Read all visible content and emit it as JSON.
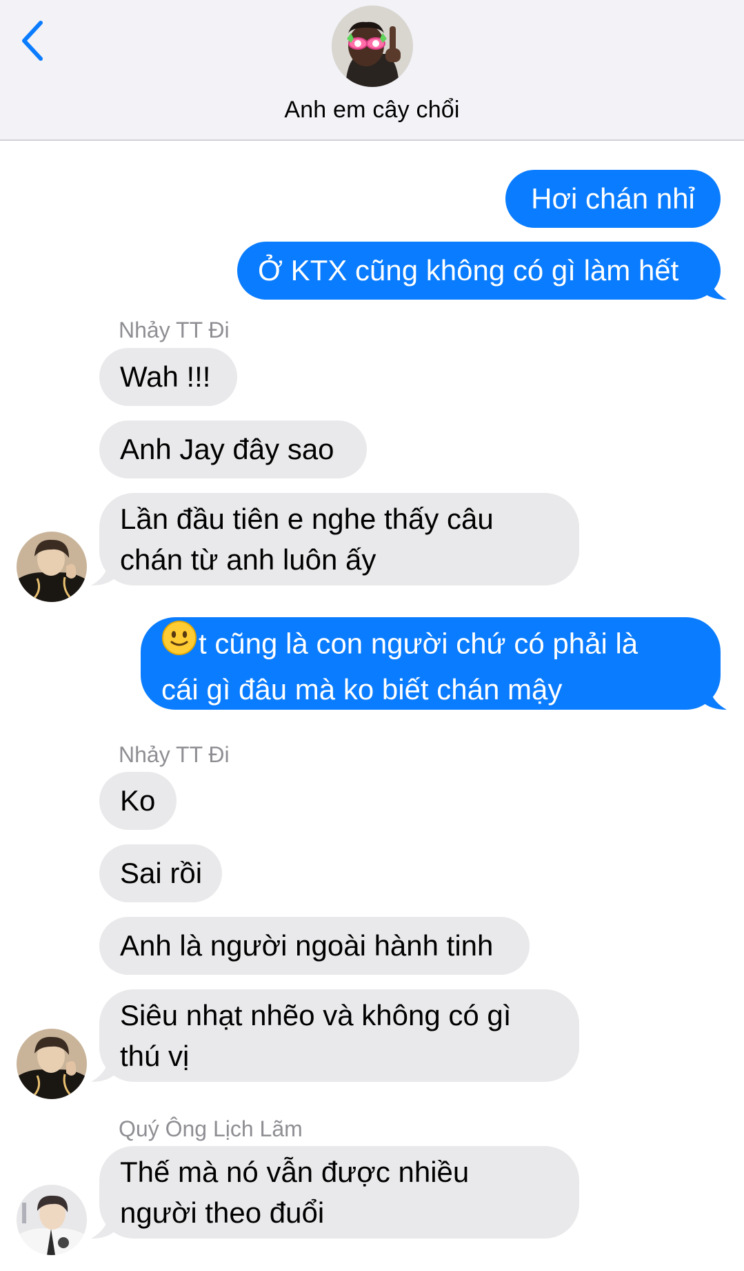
{
  "header": {
    "group_name": "Anh em cây chổi"
  },
  "colors": {
    "outgoing_bubble": "#0a7cff",
    "incoming_bubble": "#e9e9eb",
    "accent": "#0a7cff"
  },
  "messages": [
    {
      "id": 1,
      "direction": "outgoing",
      "text": "Hơi chán nhỉ"
    },
    {
      "id": 2,
      "direction": "outgoing",
      "text": "Ở KTX cũng không có gì làm hết"
    },
    {
      "id": 3,
      "direction": "incoming",
      "sender": "Nhảy TT Đi",
      "text": "Wah !!!"
    },
    {
      "id": 4,
      "direction": "incoming",
      "text": "Anh Jay đây sao"
    },
    {
      "id": 5,
      "direction": "incoming",
      "lines": [
        "Lần đầu tiên e nghe thấy câu",
        "chán từ anh luôn ấy"
      ]
    },
    {
      "id": 6,
      "direction": "outgoing",
      "emoji": "slightly-smiling-face",
      "lines": [
        "t cũng là con người chứ có phải là",
        "cái gì đâu mà ko biết chán mậy"
      ]
    },
    {
      "id": 7,
      "direction": "incoming",
      "sender": "Nhảy TT Đi",
      "text": "Ko"
    },
    {
      "id": 8,
      "direction": "incoming",
      "text": "Sai rồi"
    },
    {
      "id": 9,
      "direction": "incoming",
      "text": "Anh là người ngoài hành tinh"
    },
    {
      "id": 10,
      "direction": "incoming",
      "lines": [
        "Siêu nhạt nhẽo và không có gì",
        "thú vị"
      ]
    },
    {
      "id": 11,
      "direction": "incoming",
      "sender": "Quý Ông Lịch Lãm",
      "lines": [
        "Thế mà nó vẫn được nhiều",
        "người theo đuổi"
      ]
    }
  ]
}
